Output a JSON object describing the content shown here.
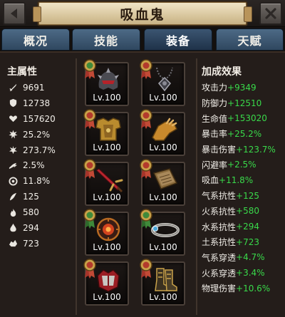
{
  "header": {
    "title": "吸血鬼"
  },
  "tabs": [
    {
      "label": "概况"
    },
    {
      "label": "技能"
    },
    {
      "label": "装备"
    },
    {
      "label": "天赋"
    }
  ],
  "main_stats": {
    "heading": "主属性",
    "items": [
      {
        "icon": "attack-icon",
        "value": "9691"
      },
      {
        "icon": "shield-icon",
        "value": "12738"
      },
      {
        "icon": "heart-icon",
        "value": "157620"
      },
      {
        "icon": "burst-icon",
        "value": "25.2%"
      },
      {
        "icon": "critical-damage-icon",
        "value": "273.7%"
      },
      {
        "icon": "dodge-icon",
        "value": "2.5%"
      },
      {
        "icon": "lifesteal-icon",
        "value": "11.8%"
      },
      {
        "icon": "wind-icon",
        "value": "125"
      },
      {
        "icon": "fire-icon",
        "value": "580"
      },
      {
        "icon": "water-drop-icon",
        "value": "294"
      },
      {
        "icon": "earth-icon",
        "value": "723"
      }
    ]
  },
  "equipment": {
    "slots": [
      {
        "name": "helmet",
        "level": "Lv.100"
      },
      {
        "name": "amulet",
        "level": "Lv.100"
      },
      {
        "name": "chest-armor",
        "level": "Lv.100"
      },
      {
        "name": "gauntlet",
        "level": "Lv.100"
      },
      {
        "name": "sword",
        "level": "Lv.100"
      },
      {
        "name": "tome",
        "level": "Lv.100"
      },
      {
        "name": "orb-shield",
        "level": "Lv.100"
      },
      {
        "name": "ring",
        "level": "Lv.100"
      },
      {
        "name": "pauldron",
        "level": "Lv.100"
      },
      {
        "name": "boots",
        "level": "Lv.100"
      }
    ]
  },
  "bonus": {
    "heading": "加成效果",
    "items": [
      {
        "label": "攻击力",
        "value": "+9349"
      },
      {
        "label": "防御力",
        "value": "+12510"
      },
      {
        "label": "生命值",
        "value": "+153020"
      },
      {
        "label": "暴击率",
        "value": "+25.2%"
      },
      {
        "label": "暴击伤害",
        "value": "+123.7%"
      },
      {
        "label": "闪避率",
        "value": "+2.5%"
      },
      {
        "label": "吸血",
        "value": "+11.8%"
      },
      {
        "label": "气系抗性",
        "value": "+125"
      },
      {
        "label": "火系抗性",
        "value": "+580"
      },
      {
        "label": "水系抗性",
        "value": "+294"
      },
      {
        "label": "土系抗性",
        "value": "+723"
      },
      {
        "label": "气系穿透",
        "value": "+4.7%"
      },
      {
        "label": "火系穿透",
        "value": "+3.4%"
      },
      {
        "label": "物理伤害",
        "value": "+10.6%"
      }
    ]
  },
  "colors": {
    "bonus_value": "#39d94a",
    "tab_blue": "#3b5571",
    "title_plate": "#e6d6b0"
  }
}
